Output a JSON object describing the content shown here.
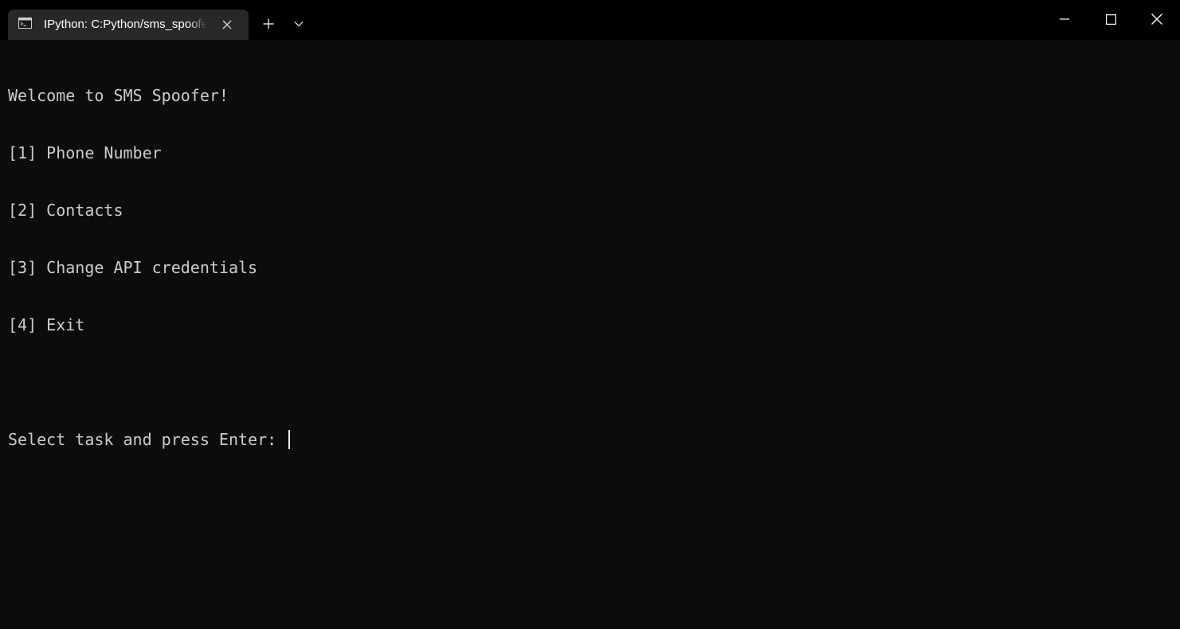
{
  "window": {
    "tab_title": "IPython: C:Python/sms_spoofer",
    "tab_icon": "console-icon",
    "controls": {
      "new_tab_icon": "plus-icon",
      "dropdown_icon": "chevron-down-icon",
      "minimize_icon": "minimize-icon",
      "maximize_icon": "maximize-icon",
      "close_icon": "close-icon"
    }
  },
  "terminal": {
    "lines": [
      "Welcome to SMS Spoofer!",
      "[1] Phone Number",
      "[2] Contacts",
      "[3] Change API credentials",
      "[4] Exit",
      "",
      "Select task and press Enter: "
    ],
    "input_value": ""
  },
  "colors": {
    "background": "#0c0c0c",
    "titlebar": "#000000",
    "active_tab": "#282828",
    "text": "#cccccc"
  }
}
